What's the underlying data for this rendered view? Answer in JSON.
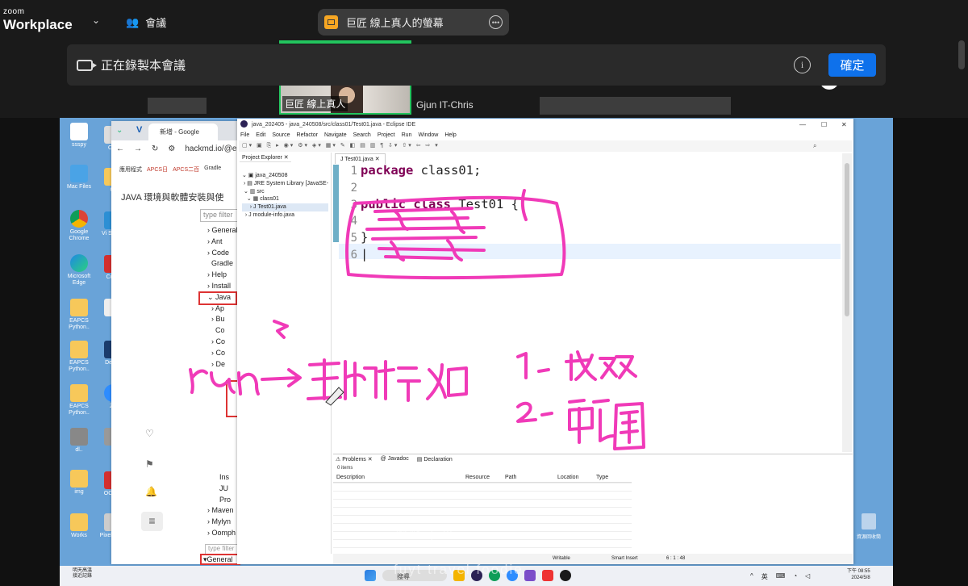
{
  "zoom": {
    "brand_small": "zoom",
    "brand_large": "Workplace",
    "meeting_label": "會議",
    "share_title": "巨匠 線上真人的螢幕",
    "recording_text": "正在錄製本會議",
    "confirm_button": "確定",
    "participants": [
      {
        "name": "巨匠 線上真人"
      },
      {
        "name": "Gjun IT-Chris"
      }
    ]
  },
  "browser": {
    "tab_title": "新增 - Google",
    "url": "hackmd.io/@e",
    "bookmarks": [
      "應用程式",
      "APCS日",
      "APCS二百",
      "Gradle"
    ],
    "page_title": "JAVA 環境與軟體安裝與使",
    "filter_placeholder": "type filter",
    "tree_items": [
      "General",
      "Ant",
      "Code",
      "Gradle",
      "Help",
      "Install",
      "Java",
      "Ap",
      "Bu",
      "Co",
      "Co",
      "Co",
      "De"
    ],
    "tree_items_lower": [
      "Ins",
      "JU",
      "Pro",
      "Maven",
      "Mylyn",
      "Oomph"
    ],
    "filter2": "type filter",
    "general_label": "General"
  },
  "eclipse": {
    "window_title": "java_202405 - java_240508/src/class01/Test01.java - Eclipse IDE",
    "menu": [
      "File",
      "Edit",
      "Source",
      "Refactor",
      "Navigate",
      "Search",
      "Project",
      "Run",
      "Window",
      "Help"
    ],
    "explorer_tab": "Project Explorer",
    "project_tree": [
      "java_240508",
      "JRE System Library [JavaSE-",
      "src",
      "class01",
      "Test01.java",
      "module-info.java"
    ],
    "editor_tab": "Test01.java",
    "code_lines": [
      {
        "n": "1",
        "text": "package class01;",
        "kw": false
      },
      {
        "n": "2",
        "text": "",
        "kw": false
      },
      {
        "n": "3",
        "text": "public class Test01 {",
        "kw": true
      },
      {
        "n": "4",
        "text": "",
        "kw": false
      },
      {
        "n": "5",
        "text": "}",
        "kw": false
      },
      {
        "n": "6",
        "text": "",
        "kw": false
      }
    ],
    "bottom_tabs": [
      "Problems",
      "Javadoc",
      "Declaration"
    ],
    "items_count": "0 items",
    "columns": [
      "Description",
      "Resource",
      "Path",
      "Location",
      "Type"
    ],
    "status": {
      "mode1": "Writable",
      "mode2": "Smart Insert",
      "pos": "6 : 1 : 48"
    }
  },
  "annotations": {
    "left": "run → 主執行入口",
    "item1": "1. 成双",
    "item2": "2. 範圍"
  },
  "taskbar": {
    "weather": "明天高溫",
    "weather_sub": "接近記錄",
    "search": "搜尋",
    "lang": "英",
    "time": "下午 08:55",
    "date": "2024/5/8"
  },
  "watermark": "蜜蜂 | 小.....",
  "watermark2": "fuyt  travel foodie",
  "colors": {
    "accent": "#0e71eb",
    "ink": "#f03ab8",
    "green": "#23c45e"
  }
}
